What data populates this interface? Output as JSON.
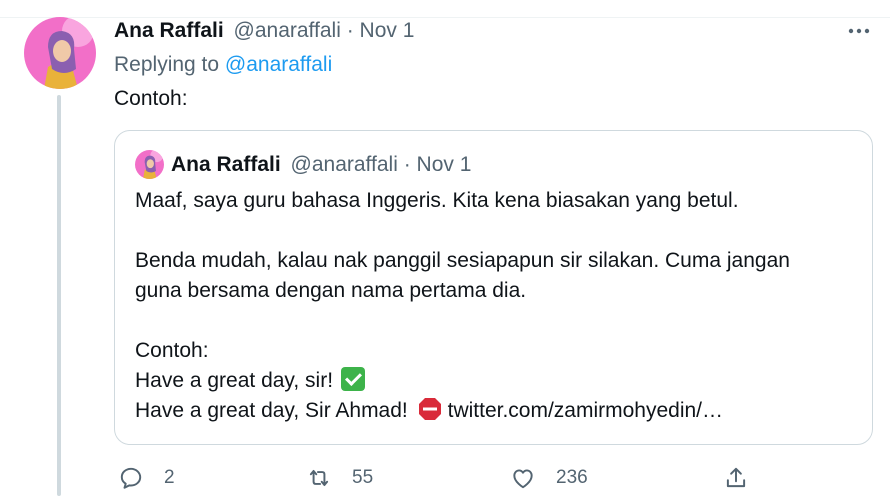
{
  "tweet": {
    "author_name": "Ana Raffali",
    "author_handle": "@anaraffali",
    "separator": " · ",
    "date": "Nov 1",
    "replying_prefix": "Replying to ",
    "replying_handle": "@anaraffali",
    "text": "Contoh:",
    "more_icon": "more-horizontal-icon"
  },
  "quote": {
    "author_name": "Ana Raffali",
    "author_handle": "@anaraffali",
    "separator": " · ",
    "date": "Nov 1",
    "line1": "Maaf, saya guru bahasa Inggeris. Kita kena biasakan yang betul.",
    "line2": "Benda mudah, kalau nak panggil sesiapapun sir silakan. Cuma jangan",
    "line3": "guna bersama dengan nama pertama dia.",
    "line4": "Contoh:",
    "line5": "Have a great day, sir!",
    "line6": "Have a great day, Sir Ahmad!",
    "link": "twitter.com/zamirmohyedin/…"
  },
  "actions": {
    "reply_count": "2",
    "retweet_count": "55",
    "like_count": "236"
  },
  "colors": {
    "accent": "#1d9bf0",
    "secondary_text": "#536471",
    "border": "#cfd9de",
    "check_emoji": "#3db34a",
    "stop_emoji": "#d92b3a"
  }
}
